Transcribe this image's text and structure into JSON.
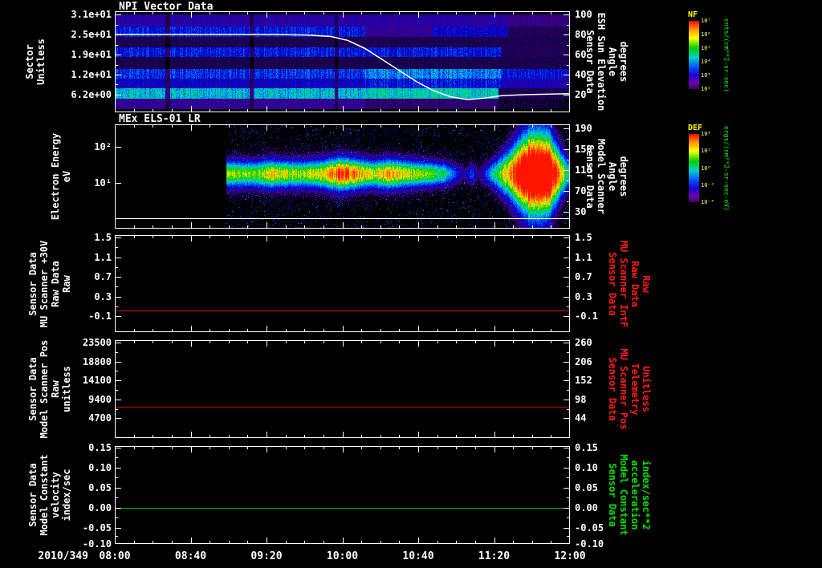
{
  "colors": {
    "background": "#000000",
    "axis": "#ffffff",
    "red_series": "#dc0000",
    "green_series": "#00c800",
    "red_label": "#ff1a1a",
    "green_label": "#00e000",
    "yellow_label": "#ffff00"
  },
  "x_axis": {
    "date_label": "2010/349",
    "tick_labels": [
      "08:00",
      "08:40",
      "09:20",
      "10:00",
      "10:40",
      "11:20",
      "12:00"
    ],
    "range_hours": [
      8,
      12
    ]
  },
  "colorbars": [
    {
      "id": "nf",
      "title": "NF",
      "title_color": "#ffff00",
      "tick_labels": [
        "10⁷",
        "10⁶",
        "10⁵",
        "10⁴",
        "10³",
        "10²"
      ],
      "tick_color": "#ffff66",
      "unit": "cnts/(cm**2-sr-sec)",
      "unit_color": "#00ff00"
    },
    {
      "id": "def",
      "title": "DEF",
      "title_color": "#ffff00",
      "tick_labels": [
        "10⁴",
        "10²",
        "10⁰",
        "10⁻²",
        "10⁻⁴"
      ],
      "tick_color": "#ffff66",
      "unit": "ergs/(cm**2-sr-sec-eV)",
      "unit_color": "#00ff00"
    }
  ],
  "chart_data": [
    {
      "id": "npi",
      "type": "heatmap",
      "title": "NPI Vector Data",
      "x_range_hours": [
        8,
        12
      ],
      "left_axis": {
        "title_lines": [
          "Sector",
          "Unitless"
        ],
        "ticks": [
          {
            "label": "3.1e+01",
            "frac": 0.032
          },
          {
            "label": "2.5e+01",
            "frac": 0.23
          },
          {
            "label": "1.9e+01",
            "frac": 0.429
          },
          {
            "label": "1.2e+01",
            "frac": 0.627
          },
          {
            "label": "6.2e+00",
            "frac": 0.825
          }
        ]
      },
      "right_axis": {
        "title_lines": [
          "Sensor Data",
          "ESH Sun Elevation",
          "Angle",
          "degrees"
        ],
        "title_color": "#ffffff",
        "ticks": [
          {
            "label": "100",
            "value": 100,
            "frac": 0.032
          },
          {
            "label": "80",
            "value": 80,
            "frac": 0.23
          },
          {
            "label": "60",
            "value": 60,
            "frac": 0.429
          },
          {
            "label": "40",
            "value": 40,
            "frac": 0.627
          },
          {
            "label": "20",
            "value": 20,
            "frac": 0.825
          }
        ]
      },
      "rows": [
        {
          "y": [
            0.03,
            0.15
          ],
          "segments": [
            [
              8,
              11.45,
              0.3
            ],
            [
              11.45,
              12,
              0.2
            ]
          ]
        },
        {
          "y": [
            0.15,
            0.25
          ],
          "segments": [
            [
              8,
              10.2,
              0.5
            ],
            [
              10.2,
              10.8,
              0.25
            ],
            [
              10.8,
              11.45,
              0.42
            ],
            [
              11.45,
              12,
              0.1
            ]
          ]
        },
        {
          "y": [
            0.25,
            0.36
          ],
          "segments": [
            [
              8,
              12,
              0.08
            ]
          ]
        },
        {
          "y": [
            0.36,
            0.455
          ],
          "segments": [
            [
              8,
              11.4,
              0.5
            ],
            [
              11.4,
              12,
              0.1
            ]
          ]
        },
        {
          "y": [
            0.455,
            0.575
          ],
          "segments": [
            [
              8,
              12,
              0.07
            ]
          ]
        },
        {
          "y": [
            0.575,
            0.67
          ],
          "segments": [
            [
              8,
              10.2,
              0.55
            ],
            [
              10.2,
              11.4,
              0.72
            ],
            [
              11.4,
              12,
              0.48
            ]
          ]
        },
        {
          "y": [
            0.67,
            0.76
          ],
          "segments": [
            [
              8,
              10.2,
              0.4
            ],
            [
              10.2,
              11.4,
              0.5
            ],
            [
              11.4,
              12,
              0.35
            ]
          ]
        },
        {
          "y": [
            0.76,
            0.865
          ],
          "segments": [
            [
              8,
              10.2,
              0.85
            ],
            [
              10.2,
              11.37,
              0.95
            ],
            [
              11.37,
              12,
              0.08
            ]
          ]
        },
        {
          "y": [
            0.865,
            0.97
          ],
          "segments": [
            [
              8,
              10.2,
              0.25
            ],
            [
              10.2,
              11.37,
              0.15
            ],
            [
              11.37,
              12,
              0.05
            ]
          ]
        }
      ],
      "gaps": [
        [
          8.44,
          8.48
        ],
        [
          9.18,
          9.22
        ],
        [
          9.93,
          9.96
        ]
      ],
      "overlay": {
        "name": "ESH Sun Elevation Angle",
        "color": "#ffffff",
        "points": [
          [
            8,
            80
          ],
          [
            9.4,
            80
          ],
          [
            9.7,
            79.5
          ],
          [
            9.9,
            78
          ],
          [
            10.05,
            74
          ],
          [
            10.2,
            66
          ],
          [
            10.35,
            55
          ],
          [
            10.5,
            44
          ],
          [
            10.65,
            33
          ],
          [
            10.8,
            24
          ],
          [
            10.95,
            18
          ],
          [
            11.1,
            15
          ],
          [
            11.25,
            16.5
          ],
          [
            11.4,
            19
          ],
          [
            11.6,
            20
          ],
          [
            12,
            21
          ]
        ]
      }
    },
    {
      "id": "els",
      "type": "spectrogram",
      "title": "MEx ELS-01 LR",
      "x_range_hours": [
        8,
        12
      ],
      "left_axis": {
        "title_lines": [
          "Electron Energy",
          "eV"
        ],
        "log10_ev_top": 2.62,
        "log10_ev_bottom": -0.27,
        "ticks": [
          {
            "label": "10²",
            "frac": 0.215
          },
          {
            "label": "10¹",
            "frac": 0.562
          }
        ]
      },
      "right_axis": {
        "title_lines": [
          "Sensor Data",
          "Model Scanner",
          "Angle",
          "degrees"
        ],
        "title_color": "#ffffff",
        "ticks": [
          {
            "label": "190",
            "frac": 0.04
          },
          {
            "label": "150",
            "frac": 0.24
          },
          {
            "label": "110",
            "frac": 0.44
          },
          {
            "label": "70",
            "frac": 0.64
          },
          {
            "label": "30",
            "frac": 0.84
          }
        ]
      },
      "data_start_hour": 8.98,
      "band_center_ev": 18,
      "white_line_ev": 1.05,
      "intensity_profile": [
        [
          8.98,
          0.7,
          0.26
        ],
        [
          9.2,
          0.66,
          0.25
        ],
        [
          9.35,
          0.78,
          0.27
        ],
        [
          9.5,
          0.74,
          0.26
        ],
        [
          9.7,
          0.7,
          0.26
        ],
        [
          9.85,
          0.8,
          0.28
        ],
        [
          9.95,
          0.97,
          0.31
        ],
        [
          10.05,
          0.95,
          0.3
        ],
        [
          10.15,
          0.85,
          0.28
        ],
        [
          10.25,
          0.74,
          0.26
        ],
        [
          10.4,
          0.86,
          0.28
        ],
        [
          10.55,
          0.76,
          0.26
        ],
        [
          10.75,
          0.66,
          0.24
        ],
        [
          10.9,
          0.55,
          0.22
        ],
        [
          11.0,
          0.28,
          0.2
        ],
        [
          11.07,
          0.12,
          0.18
        ],
        [
          11.13,
          0.35,
          0.2
        ],
        [
          11.2,
          0.1,
          0.18
        ],
        [
          11.3,
          0.45,
          0.24
        ],
        [
          11.45,
          0.8,
          0.45
        ],
        [
          11.55,
          1.1,
          0.65
        ],
        [
          11.65,
          1.35,
          0.8
        ],
        [
          11.8,
          1.3,
          0.78
        ],
        [
          11.9,
          0.9,
          0.5
        ],
        [
          11.97,
          0.6,
          0.33
        ],
        [
          12,
          0.5,
          0.3
        ]
      ]
    },
    {
      "id": "mu30v",
      "type": "line",
      "left_axis": {
        "title_lines": [
          "Sensor Data",
          "MU Scanner +30V",
          "Raw Data",
          "Raw"
        ],
        "ticks": [
          {
            "label": "1.5",
            "frac": 0.025
          },
          {
            "label": "1.1",
            "frac": 0.231
          },
          {
            "label": "0.7",
            "frac": 0.43
          },
          {
            "label": "0.3",
            "frac": 0.636
          },
          {
            "label": "-0.1",
            "frac": 0.835
          }
        ]
      },
      "right_axis": {
        "title_lines": [
          "Sensor Data",
          "MU Scanner IntF",
          "Raw Data",
          "Raw"
        ],
        "title_color": "#ff1a1a",
        "ticks": [
          {
            "label": "1.5",
            "frac": 0.025
          },
          {
            "label": "1.1",
            "frac": 0.231
          },
          {
            "label": "0.7",
            "frac": 0.43
          },
          {
            "label": "0.3",
            "frac": 0.636
          },
          {
            "label": "-0.1",
            "frac": 0.835
          }
        ]
      },
      "series": [
        {
          "name": "MU Scanner +30V Raw",
          "color": "#dc0000",
          "value": 0.0,
          "value_frac": 0.777
        }
      ]
    },
    {
      "id": "scanpos",
      "type": "line",
      "left_axis": {
        "title_lines": [
          "Sensor Data",
          "Model Scanner Pos",
          "Raw",
          "unitless"
        ],
        "ticks": [
          {
            "label": "23500",
            "frac": 0.025
          },
          {
            "label": "18800",
            "frac": 0.221
          },
          {
            "label": "14100",
            "frac": 0.41
          },
          {
            "label": "9400",
            "frac": 0.607
          },
          {
            "label": "4700",
            "frac": 0.795
          }
        ]
      },
      "right_axis": {
        "title_lines": [
          "Sensor Data",
          "MU Scanner Pos",
          "Telemetry",
          "Unitless"
        ],
        "title_color": "#ff1a1a",
        "ticks": [
          {
            "label": "260",
            "frac": 0.025
          },
          {
            "label": "206",
            "frac": 0.221
          },
          {
            "label": "152",
            "frac": 0.41
          },
          {
            "label": "98",
            "frac": 0.607
          },
          {
            "label": "44",
            "frac": 0.795
          }
        ]
      },
      "series": [
        {
          "name": "Model Scanner Pos Raw",
          "color": "#dc0000",
          "value": 8000,
          "value_frac": 0.68
        }
      ]
    },
    {
      "id": "model",
      "type": "line",
      "left_axis": {
        "title_lines": [
          "Sensor Data",
          "Model Constant",
          "velocity",
          "index/sec"
        ],
        "ticks": [
          {
            "label": "0.15",
            "frac": 0.016
          },
          {
            "label": "0.10",
            "frac": 0.221
          },
          {
            "label": "0.05",
            "frac": 0.426
          },
          {
            "label": "0.00",
            "frac": 0.631
          },
          {
            "label": "-0.05",
            "frac": 0.836
          },
          {
            "label": "-0.10",
            "frac": 1.0
          }
        ]
      },
      "right_axis": {
        "title_lines": [
          "Sensor Data",
          "Model Constant",
          "acceleration",
          "index/sec**2"
        ],
        "title_color": "#00e000",
        "ticks": [
          {
            "label": "0.15",
            "frac": 0.016
          },
          {
            "label": "0.10",
            "frac": 0.221
          },
          {
            "label": "0.05",
            "frac": 0.426
          },
          {
            "label": "0.00",
            "frac": 0.631
          },
          {
            "label": "-0.05",
            "frac": 0.836
          },
          {
            "label": "-0.10",
            "frac": 1.0
          }
        ]
      },
      "series": [
        {
          "name": "Model Constant velocity",
          "color": "#00c800",
          "value": 0.0,
          "value_frac": 0.631
        }
      ]
    }
  ]
}
